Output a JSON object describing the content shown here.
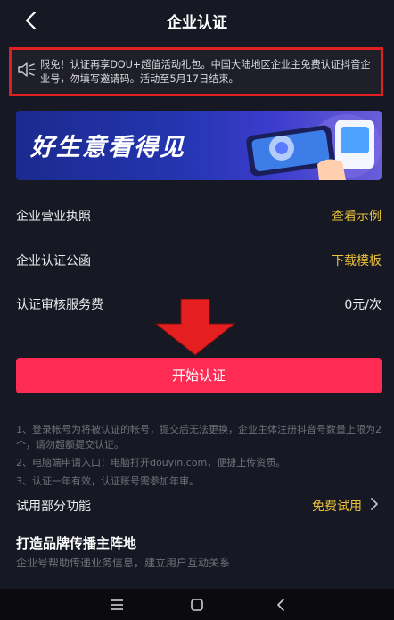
{
  "header": {
    "title": "企业认证"
  },
  "notice": {
    "text": "限免！认证再享DOU+超值活动礼包。中国大陆地区企业主免费认证抖音企业号，勿填写邀请码。活动至5月17日结束。"
  },
  "banner": {
    "text": "好生意看得见"
  },
  "rows": [
    {
      "label": "企业营业执照",
      "value": "查看示例"
    },
    {
      "label": "企业认证公函",
      "value": "下载模板"
    },
    {
      "label": "认证审核服务费",
      "value": "0元/次"
    }
  ],
  "start_button": {
    "label": "开始认证"
  },
  "notes": [
    "1、登录帐号为将被认证的帐号，提交后无法更换，企业主体注册抖音号数量上限为2个，请勿超额提交认证。",
    "2、电脑端申请入口：电脑打开douyin.com，便捷上传资质。",
    "3、认证一年有效，认证账号需参加年审。"
  ],
  "trial": {
    "label": "试用部分功能",
    "value": "免费试用"
  },
  "brand": {
    "title": "打造品牌传播主阵地",
    "subtitle": "企业号帮助传递业务信息，建立用户互动关系"
  },
  "colors": {
    "accent": "#fe2c55",
    "link": "#e9c13b",
    "background": "#161823",
    "highlight_border": "#e02020"
  },
  "icons": {
    "back": "chevron-left-icon",
    "notice": "speaker-icon",
    "nav": [
      "menu-icon",
      "home-square-icon",
      "back-triangle-icon"
    ]
  }
}
